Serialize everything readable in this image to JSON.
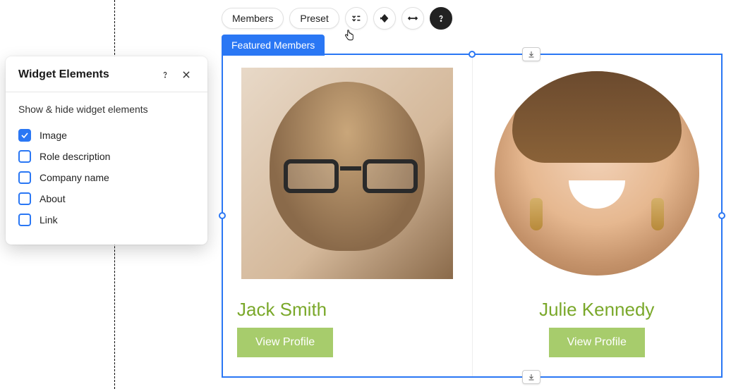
{
  "panel": {
    "title": "Widget Elements",
    "subtitle": "Show & hide widget elements",
    "items": [
      {
        "label": "Image",
        "checked": true
      },
      {
        "label": "Role description",
        "checked": false
      },
      {
        "label": "Company name",
        "checked": false
      },
      {
        "label": "About",
        "checked": false
      },
      {
        "label": "Link",
        "checked": false
      }
    ]
  },
  "toolbar": {
    "members_label": "Members",
    "preset_label": "Preset"
  },
  "widget": {
    "tab_label": "Featured Members",
    "members": [
      {
        "name": "Jack Smith",
        "button_label": "View Profile"
      },
      {
        "name": "Julie Kennedy",
        "button_label": "View Profile"
      }
    ]
  }
}
